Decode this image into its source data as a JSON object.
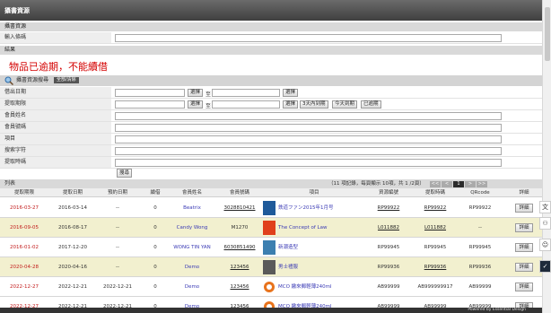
{
  "header": {
    "title": "攝書資源"
  },
  "query_section": {
    "title": "攝書資源",
    "label": "輸入條碼",
    "value": ""
  },
  "result_section": {
    "title": "結果",
    "message": "物品已逾期，不能續借"
  },
  "search_panel": {
    "title": "攝書資源搜尋",
    "tag": "全部/清除",
    "fields": [
      {
        "label": "借出日期",
        "from": "",
        "to": ""
      },
      {
        "label": "提取期限",
        "from": "",
        "to": ""
      },
      {
        "label": "會員姓名",
        "value": ""
      },
      {
        "label": "會員號碼",
        "value": ""
      },
      {
        "label": "項目",
        "value": ""
      },
      {
        "label": "搜索字符",
        "value": ""
      },
      {
        "label": "提取時碼",
        "value": ""
      }
    ],
    "select_label": "選擇",
    "range_sep": "至",
    "quick_buttons": [
      "3天內到期",
      "今天到期",
      "已逾期"
    ],
    "search_button": "搜尋"
  },
  "list": {
    "title": "列表",
    "pager_text": "（11 項記錄，每頁顯示 10項，共 1 /2頁）",
    "page_buttons": [
      "<<",
      "<",
      "1",
      ">",
      ">>"
    ],
    "columns": [
      "提取期限",
      "提取日期",
      "預約日期",
      "續借",
      "會員姓名",
      "會員號碼",
      "項目",
      "資源編號",
      "提取時碼",
      "QRcode",
      "詳細"
    ],
    "rows": [
      {
        "due": "2016-03-27",
        "pickup": "2016-03-14",
        "reserve": "--",
        "renew": "0",
        "member": "Beatrix",
        "member_no": "3028810421",
        "item": "鉄道ファン2015年1月号",
        "res_no": "RP99922",
        "code": "RP99922",
        "qr": "RP99922",
        "detail": "詳細",
        "thumb": "#1f5a9a"
      },
      {
        "due": "2016-09-05",
        "pickup": "2016-08-17",
        "reserve": "--",
        "renew": "0",
        "member": "Candy Wong",
        "member_no": "M1270",
        "item": "The Concept of Law",
        "res_no": "L011882",
        "code": "L011882",
        "qr": "--",
        "detail": "詳細",
        "thumb": "#e0401c"
      },
      {
        "due": "2016-01-02",
        "pickup": "2017-12-20",
        "reserve": "--",
        "renew": "0",
        "member": "WONG TIN YAN",
        "member_no": "6030851490",
        "item": "新潮造型",
        "res_no": "RP99945",
        "code": "RP99945",
        "qr": "RP99945",
        "detail": "詳細",
        "thumb": "#3c7fb0"
      },
      {
        "due": "2020-04-28",
        "pickup": "2020-04-16",
        "reserve": "--",
        "renew": "0",
        "member": "Demo",
        "member_no": "123456",
        "item": "男士禮服",
        "res_no": "RP99936",
        "code": "RP99936",
        "qr": "RP99936",
        "detail": "詳細",
        "thumb": "#5a5a5a"
      },
      {
        "due": "2022-12-27",
        "pickup": "2022-12-21",
        "reserve": "2022-12-21",
        "renew": "0",
        "member": "Demo",
        "member_no": "123456",
        "item": "MCO 繳來郵輕薄240ml",
        "res_no": "AB99999",
        "code": "AB999999917",
        "qr": "AB99999",
        "detail": "詳細",
        "thumb": "#e8731c"
      },
      {
        "due": "2022-12-27",
        "pickup": "2022-12-21",
        "reserve": "2022-12-21",
        "renew": "0",
        "member": "Demo",
        "member_no": "123456",
        "item": "MCO 繳來郵輕薄240ml",
        "res_no": "AB99999",
        "code": "AB99999",
        "qr": "AB99999",
        "detail": "詳細",
        "thumb": "#e8731c"
      }
    ]
  },
  "footer": {
    "text": "Powered by Essential Design"
  }
}
